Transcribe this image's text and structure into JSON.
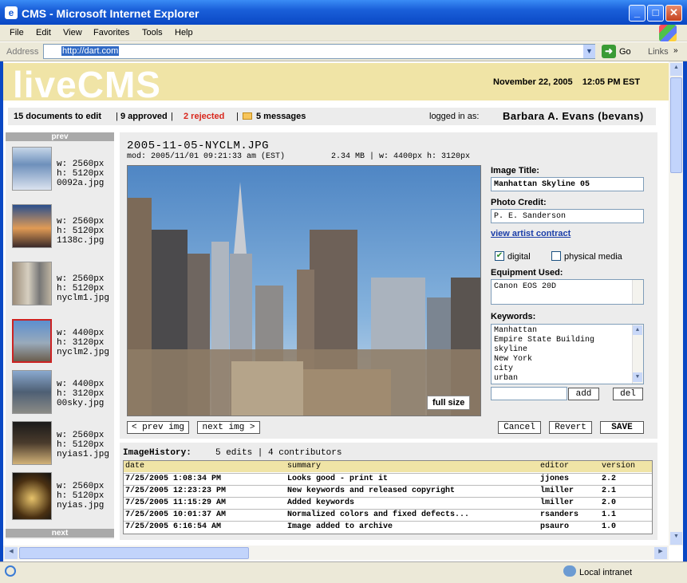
{
  "window": {
    "title": "CMS - Microsoft Internet Explorer",
    "icon": "ie-icon"
  },
  "menu": [
    "File",
    "Edit",
    "View",
    "Favorites",
    "Tools",
    "Help"
  ],
  "address": {
    "label": "Address",
    "url": "http://dart.com",
    "go": "Go",
    "links": "Links"
  },
  "header": {
    "logo": "liveCMS",
    "datetime": "November 22, 2005    12:05 PM EST"
  },
  "status": {
    "to_edit": "15 documents to edit",
    "approved": "9 approved",
    "rejected": "2 rejected",
    "messages": "5 messages",
    "logged_in_label": "logged in as:",
    "user": "Barbara A. Evans (bevans)"
  },
  "sidebar": {
    "prev": "prev",
    "next": "next",
    "thumbs": [
      {
        "w": "w: 2560px",
        "h": "h: 5120px",
        "file": "0092a.jpg"
      },
      {
        "w": "w: 2560px",
        "h": "h: 5120px",
        "file": "1138c.jpg"
      },
      {
        "w": "w: 2560px",
        "h": "h: 5120px",
        "file": "nyclm1.jpg"
      },
      {
        "w": "w: 4400px",
        "h": "h: 3120px",
        "file": "nyclm2.jpg"
      },
      {
        "w": "w: 4400px",
        "h": "h: 3120px",
        "file": "00sky.jpg"
      },
      {
        "w": "w: 2560px",
        "h": "h: 5120px",
        "file": "nyias1.jpg"
      },
      {
        "w": "w: 2560px",
        "h": "h: 5120px",
        "file": "nyias.jpg"
      }
    ]
  },
  "doc": {
    "filename": "2005-11-05-NYCLM.JPG",
    "modified": "mod: 2005/11/01 09:21:33 am (EST)",
    "size": "2.34 MB | w: 4400px h: 3120px",
    "full_size": "full size",
    "prev_img": "< prev img",
    "next_img": "next img >"
  },
  "form": {
    "title_label": "Image Title:",
    "title_value": "Manhattan Skyline 05",
    "credit_label": "Photo Credit:",
    "credit_value": "P. E. Sanderson",
    "contract_link": "view artist contract",
    "digital": "digital",
    "physical": "physical media",
    "equipment_label": "Equipment Used:",
    "equipment_value": "Canon EOS 20D",
    "keywords_label": "Keywords:",
    "keywords": [
      "Manhattan",
      "Empire State Building",
      "skyline",
      "New York",
      "city",
      "urban"
    ],
    "add": "add",
    "del": "del",
    "cancel": "Cancel",
    "revert": "Revert",
    "save": "SAVE"
  },
  "history": {
    "title": "ImageHistory:",
    "meta": "5 edits | 4 contributors",
    "columns": [
      "date",
      "summary",
      "editor",
      "version"
    ],
    "rows": [
      [
        "7/25/2005 1:08:34 PM",
        "Looks good - print it",
        "jjones",
        "2.2"
      ],
      [
        "7/25/2005 12:23:23 PM",
        "New keywords and released copyright",
        "lmiller",
        "2.1"
      ],
      [
        "7/25/2005 11:15:29 AM",
        "Added keywords",
        "lmiller",
        "2.0"
      ],
      [
        "7/25/2005 10:01:37 AM",
        "Normalized colors and fixed defects...",
        "rsanders",
        "1.1"
      ],
      [
        "7/25/2005 6:16:54 AM",
        "Image added to archive",
        "psauro",
        "1.0"
      ]
    ]
  },
  "statusline": {
    "zone": "Local intranet"
  }
}
